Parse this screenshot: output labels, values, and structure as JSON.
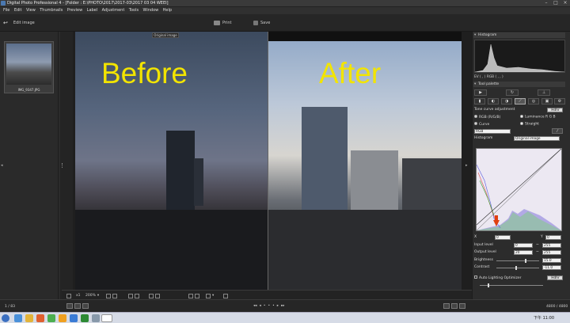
{
  "window": {
    "title": "Digital Photo Professional 4 - [Folder : E:\\PHOTO\\2017\\2017-03\\2017 03 04 WEEI]"
  },
  "menu": [
    "File",
    "Edit",
    "View",
    "Thumbnails",
    "Preview",
    "Label",
    "Adjustment",
    "Tools",
    "Window",
    "Help"
  ],
  "toolbar": {
    "edit_image": "Edit image",
    "print": "Print",
    "save": "Save"
  },
  "thumbnail": {
    "filename": "IMG_9347.JPG"
  },
  "preview": {
    "overlay_label": "Original image",
    "before_label": "Before",
    "after_label": "After"
  },
  "bottom_bar": {
    "one_to_one": "x1",
    "zoom": "200%"
  },
  "status": {
    "left": "1 / 83",
    "right": "4800 / 4800"
  },
  "right_panel": {
    "histogram_title": "Histogram",
    "ev_label": "EV ( , )   RGB ( , , )",
    "tool_palette_title": "Tool palette",
    "tone_curve_adjustment": "Tone curve adjustment",
    "reset_button": "Hdhr",
    "mode_rgb": "RGB (R/G/B)",
    "mode_lum": "Luminance R G B",
    "curve_label": "Curve",
    "straight_label": "Straight",
    "channel_value": "RGB",
    "histogram_label": "Histogram",
    "histogram_source": "Original image",
    "x_label": "X",
    "x_value": "0",
    "y_label": "Y",
    "y_value": "0",
    "input_level_label": "Input level",
    "input_level_min": "0",
    "input_level_max": "255",
    "output_level_label": "Output level",
    "output_level_min": "20",
    "output_level_max": "255",
    "brightness_label": "Brightness",
    "brightness_value": "15.0",
    "contrast_label": "Contrast",
    "contrast_value": "-11.0",
    "alo_label": "Auto Lighting Optimizer",
    "alo_button": "Hdhr"
  },
  "taskbar": {
    "time": "下午 11:00"
  }
}
